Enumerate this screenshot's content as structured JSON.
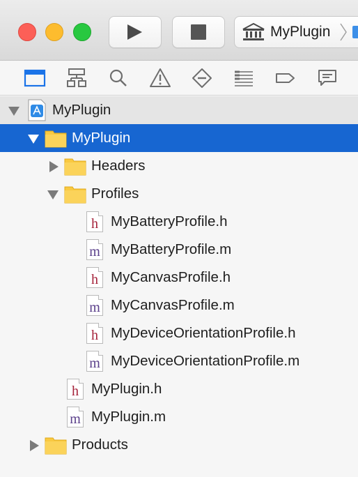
{
  "toolbar": {
    "scheme_label": "MyPlugin",
    "run_icon": "play-icon",
    "stop_icon": "stop-icon"
  },
  "navigator_tabs": [
    {
      "name": "project-navigator",
      "icon": "folder-icon",
      "active": true
    },
    {
      "name": "symbol-navigator",
      "icon": "hierarchy-icon"
    },
    {
      "name": "find-navigator",
      "icon": "search-icon"
    },
    {
      "name": "issue-navigator",
      "icon": "warning-icon"
    },
    {
      "name": "test-navigator",
      "icon": "diamond-minus-icon"
    },
    {
      "name": "debug-navigator",
      "icon": "list-icon"
    },
    {
      "name": "breakpoint-navigator",
      "icon": "tag-icon"
    },
    {
      "name": "report-navigator",
      "icon": "speech-bubble-icon"
    }
  ],
  "tree": {
    "project": "MyPlugin",
    "group": "MyPlugin",
    "headers": "Headers",
    "profiles": "Profiles",
    "files": [
      {
        "name": "MyBatteryProfile.h",
        "type": "h"
      },
      {
        "name": "MyBatteryProfile.m",
        "type": "m"
      },
      {
        "name": "MyCanvasProfile.h",
        "type": "h"
      },
      {
        "name": "MyCanvasProfile.m",
        "type": "m"
      },
      {
        "name": "MyDeviceOrientationProfile.h",
        "type": "h"
      },
      {
        "name": "MyDeviceOrientationProfile.m",
        "type": "m"
      }
    ],
    "plugin_h": "MyPlugin.h",
    "plugin_m": "MyPlugin.m",
    "products": "Products",
    "h_glyph": "h",
    "m_glyph": "m"
  },
  "colors": {
    "selection": "#1766d1",
    "folder": "#f9c941",
    "accent": "#1a73e8"
  }
}
